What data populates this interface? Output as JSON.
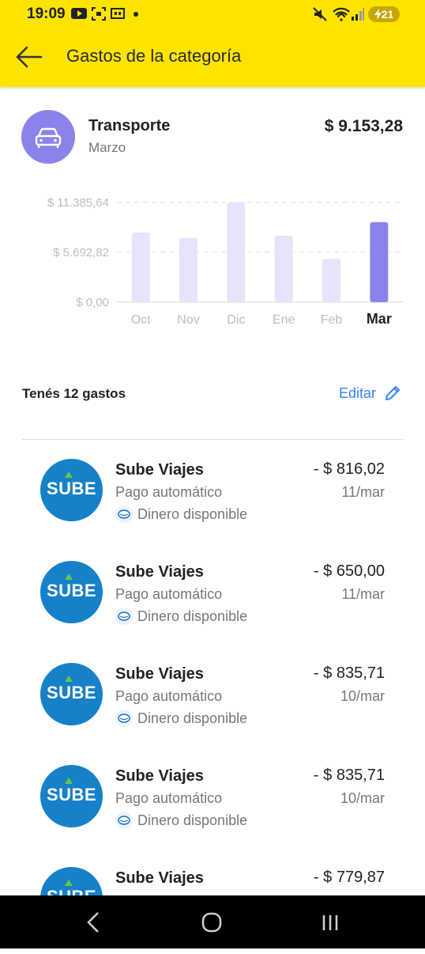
{
  "status_bar": {
    "time": "19:09",
    "battery": "21"
  },
  "header": {
    "title": "Gastos de la categoría"
  },
  "category": {
    "icon": "car-icon",
    "name": "Transporte",
    "month": "Marzo",
    "total": "$ 9.153,28"
  },
  "chart_data": {
    "type": "bar",
    "categories": [
      "Oct",
      "Nov",
      "Dic",
      "Ene",
      "Feb",
      "Mar"
    ],
    "values": [
      7950,
      7350,
      11385.64,
      7600,
      4950,
      9153.28
    ],
    "y_ticks": [
      "$ 11.385,64",
      "$ 5.692,82",
      "$ 0,00"
    ],
    "ylim": [
      0,
      11385.64
    ],
    "highlighted": "Mar",
    "colors": {
      "bar": "#e6e3fb",
      "highlight": "#8b83ec"
    }
  },
  "summary": {
    "count_text": "Tenés 12 gastos",
    "edit_label": "Editar"
  },
  "transactions": [
    {
      "title": "Sube Viajes",
      "subtitle": "Pago automático",
      "source": "Dinero disponible",
      "amount": "- $ 816,02",
      "date": "11/mar",
      "logo_text": "SUBE"
    },
    {
      "title": "Sube Viajes",
      "subtitle": "Pago automático",
      "source": "Dinero disponible",
      "amount": "- $ 650,00",
      "date": "11/mar",
      "logo_text": "SUBE"
    },
    {
      "title": "Sube Viajes",
      "subtitle": "Pago automático",
      "source": "Dinero disponible",
      "amount": "- $ 835,71",
      "date": "10/mar",
      "logo_text": "SUBE"
    },
    {
      "title": "Sube Viajes",
      "subtitle": "Pago automático",
      "source": "Dinero disponible",
      "amount": "- $ 835,71",
      "date": "10/mar",
      "logo_text": "SUBE"
    },
    {
      "title": "Sube Viajes",
      "subtitle": "",
      "source": "",
      "amount": "- $ 779,87",
      "date": "",
      "logo_text": "SUBE"
    }
  ],
  "nav": {
    "back": "back-icon",
    "home": "home-icon",
    "recents": "recents-icon"
  },
  "colors": {
    "brand_yellow": "#fde400",
    "accent_blue": "#3483fa",
    "category_purple": "#8b83ec",
    "sube_blue": "#1681c8"
  }
}
